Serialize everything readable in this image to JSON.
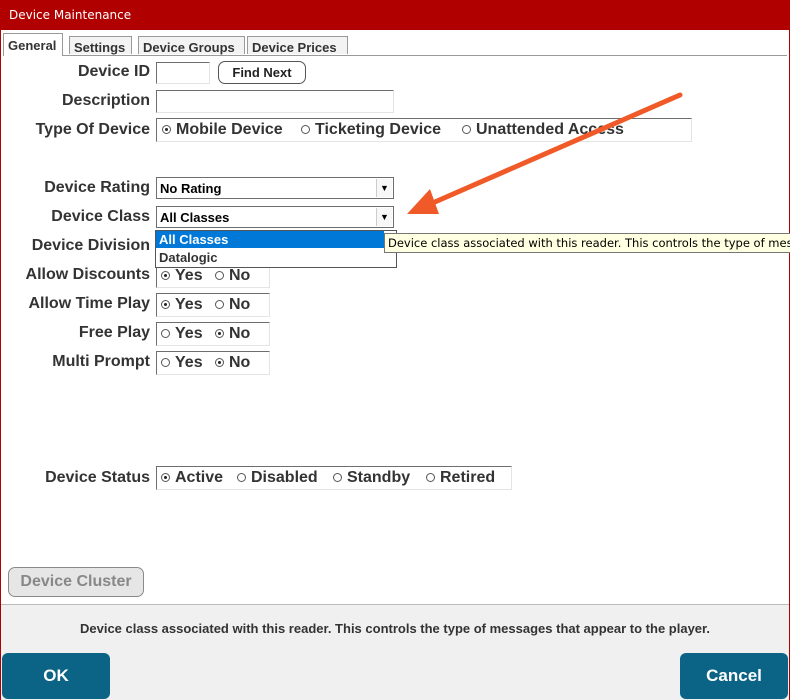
{
  "window": {
    "title": "Device Maintenance"
  },
  "tabs": [
    {
      "label": "General"
    },
    {
      "label": "Settings"
    },
    {
      "label": "Device Groups"
    },
    {
      "label": "Device Prices"
    }
  ],
  "form": {
    "device_id": {
      "label": "Device ID",
      "value": "",
      "find_next": "Find Next"
    },
    "description": {
      "label": "Description",
      "value": ""
    },
    "type_of_device": {
      "label": "Type Of Device",
      "options": [
        "Mobile Device",
        "Ticketing Device",
        "Unattended Access"
      ],
      "selected": "Mobile Device"
    },
    "device_rating": {
      "label": "Device Rating",
      "value": "No Rating"
    },
    "device_class": {
      "label": "Device Class",
      "value": "All Classes",
      "options": [
        "All Classes",
        "Datalogic"
      ],
      "highlighted": "All Classes"
    },
    "device_division": {
      "label": "Device Division"
    },
    "allow_discounts": {
      "label": "Allow Discounts",
      "options": [
        "Yes",
        "No"
      ],
      "selected": "Yes"
    },
    "allow_time_play": {
      "label": "Allow Time Play",
      "options": [
        "Yes",
        "No"
      ],
      "selected": "Yes"
    },
    "free_play": {
      "label": "Free Play",
      "options": [
        "Yes",
        "No"
      ],
      "selected": "No"
    },
    "multi_prompt": {
      "label": "Multi Prompt",
      "options": [
        "Yes",
        "No"
      ],
      "selected": "No"
    },
    "device_status": {
      "label": "Device Status",
      "options": [
        "Active",
        "Disabled",
        "Standby",
        "Retired"
      ],
      "selected": "Active"
    }
  },
  "tooltip": "Device class associated with this reader.  This controls the type of messages that appear to the player.",
  "buttons": {
    "device_cluster": "Device Cluster",
    "ok": "OK",
    "cancel": "Cancel"
  },
  "help_text": "Device class associated with this reader.  This controls the type of messages that appear to the player.",
  "colors": {
    "title_bar": "#b00000",
    "action_button": "#0b6486",
    "selection": "#0078d7",
    "arrow": "#f05a28",
    "tooltip_bg": "#ffffe1"
  },
  "icons": {
    "dropdown": "chevron-down-icon",
    "annotation": "arrow-annotation-icon"
  }
}
